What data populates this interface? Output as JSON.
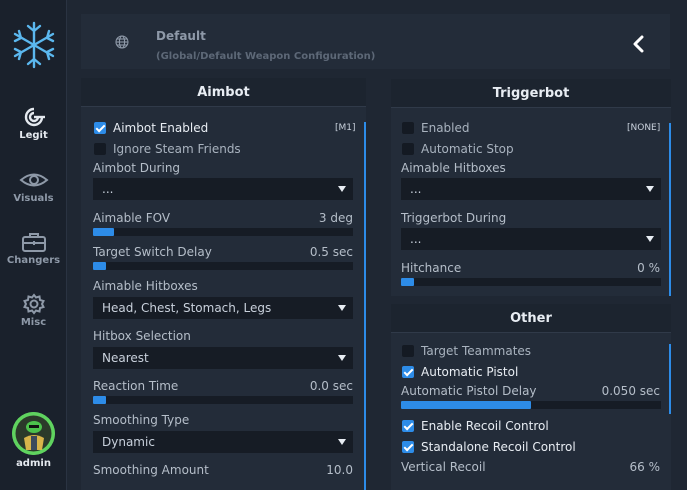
{
  "sidebar": {
    "items": [
      {
        "label": "Legit",
        "icon": "target-icon"
      },
      {
        "label": "Visuals",
        "icon": "eye-icon"
      },
      {
        "label": "Changers",
        "icon": "briefcase-icon"
      },
      {
        "label": "Misc",
        "icon": "gear-icon"
      }
    ],
    "user": "admin"
  },
  "header": {
    "title": "Default",
    "subtitle": "(Global/Default Weapon Configuration)"
  },
  "aimbot": {
    "title": "Aimbot",
    "enabled_label": "Aimbot Enabled",
    "enabled": true,
    "enabled_key": "[M1]",
    "ignore_friends_label": "Ignore Steam Friends",
    "ignore_friends": false,
    "during_label": "Aimbot During",
    "during_value": "...",
    "fov_label": "Aimable FOV",
    "fov_value": "3 deg",
    "fov_fraction": 0.08,
    "switch_label": "Target Switch Delay",
    "switch_value": "0.5 sec",
    "switch_fraction": 0.05,
    "hitboxes_label": "Aimable Hitboxes",
    "hitboxes_value": "Head, Chest, Stomach, Legs",
    "selection_label": "Hitbox Selection",
    "selection_value": "Nearest",
    "reaction_label": "Reaction Time",
    "reaction_value": "0.0 sec",
    "reaction_fraction": 0.05,
    "smooth_type_label": "Smoothing Type",
    "smooth_type_value": "Dynamic",
    "smooth_amount_label": "Smoothing Amount",
    "smooth_amount_value": "10.0"
  },
  "triggerbot": {
    "title": "Triggerbot",
    "enabled_label": "Enabled",
    "enabled": false,
    "enabled_key": "[NONE]",
    "auto_stop_label": "Automatic Stop",
    "auto_stop": false,
    "hitboxes_label": "Aimable Hitboxes",
    "hitboxes_value": "...",
    "during_label": "Triggerbot During",
    "during_value": "...",
    "hitchance_label": "Hitchance",
    "hitchance_value": "0 %",
    "hitchance_fraction": 0.05
  },
  "other": {
    "title": "Other",
    "teammates_label": "Target Teammates",
    "teammates": false,
    "auto_pistol_label": "Automatic Pistol",
    "auto_pistol": true,
    "pistol_delay_label": "Automatic Pistol Delay",
    "pistol_delay_value": "0.050 sec",
    "pistol_delay_fraction": 0.5,
    "recoil_label": "Enable Recoil Control",
    "recoil": true,
    "standalone_label": "Standalone Recoil Control",
    "standalone": true,
    "vertical_label": "Vertical Recoil",
    "vertical_value": "66 %"
  },
  "colors": {
    "accent": "#2d8ce8",
    "bg": "#1f2733",
    "panel": "#232c39"
  }
}
